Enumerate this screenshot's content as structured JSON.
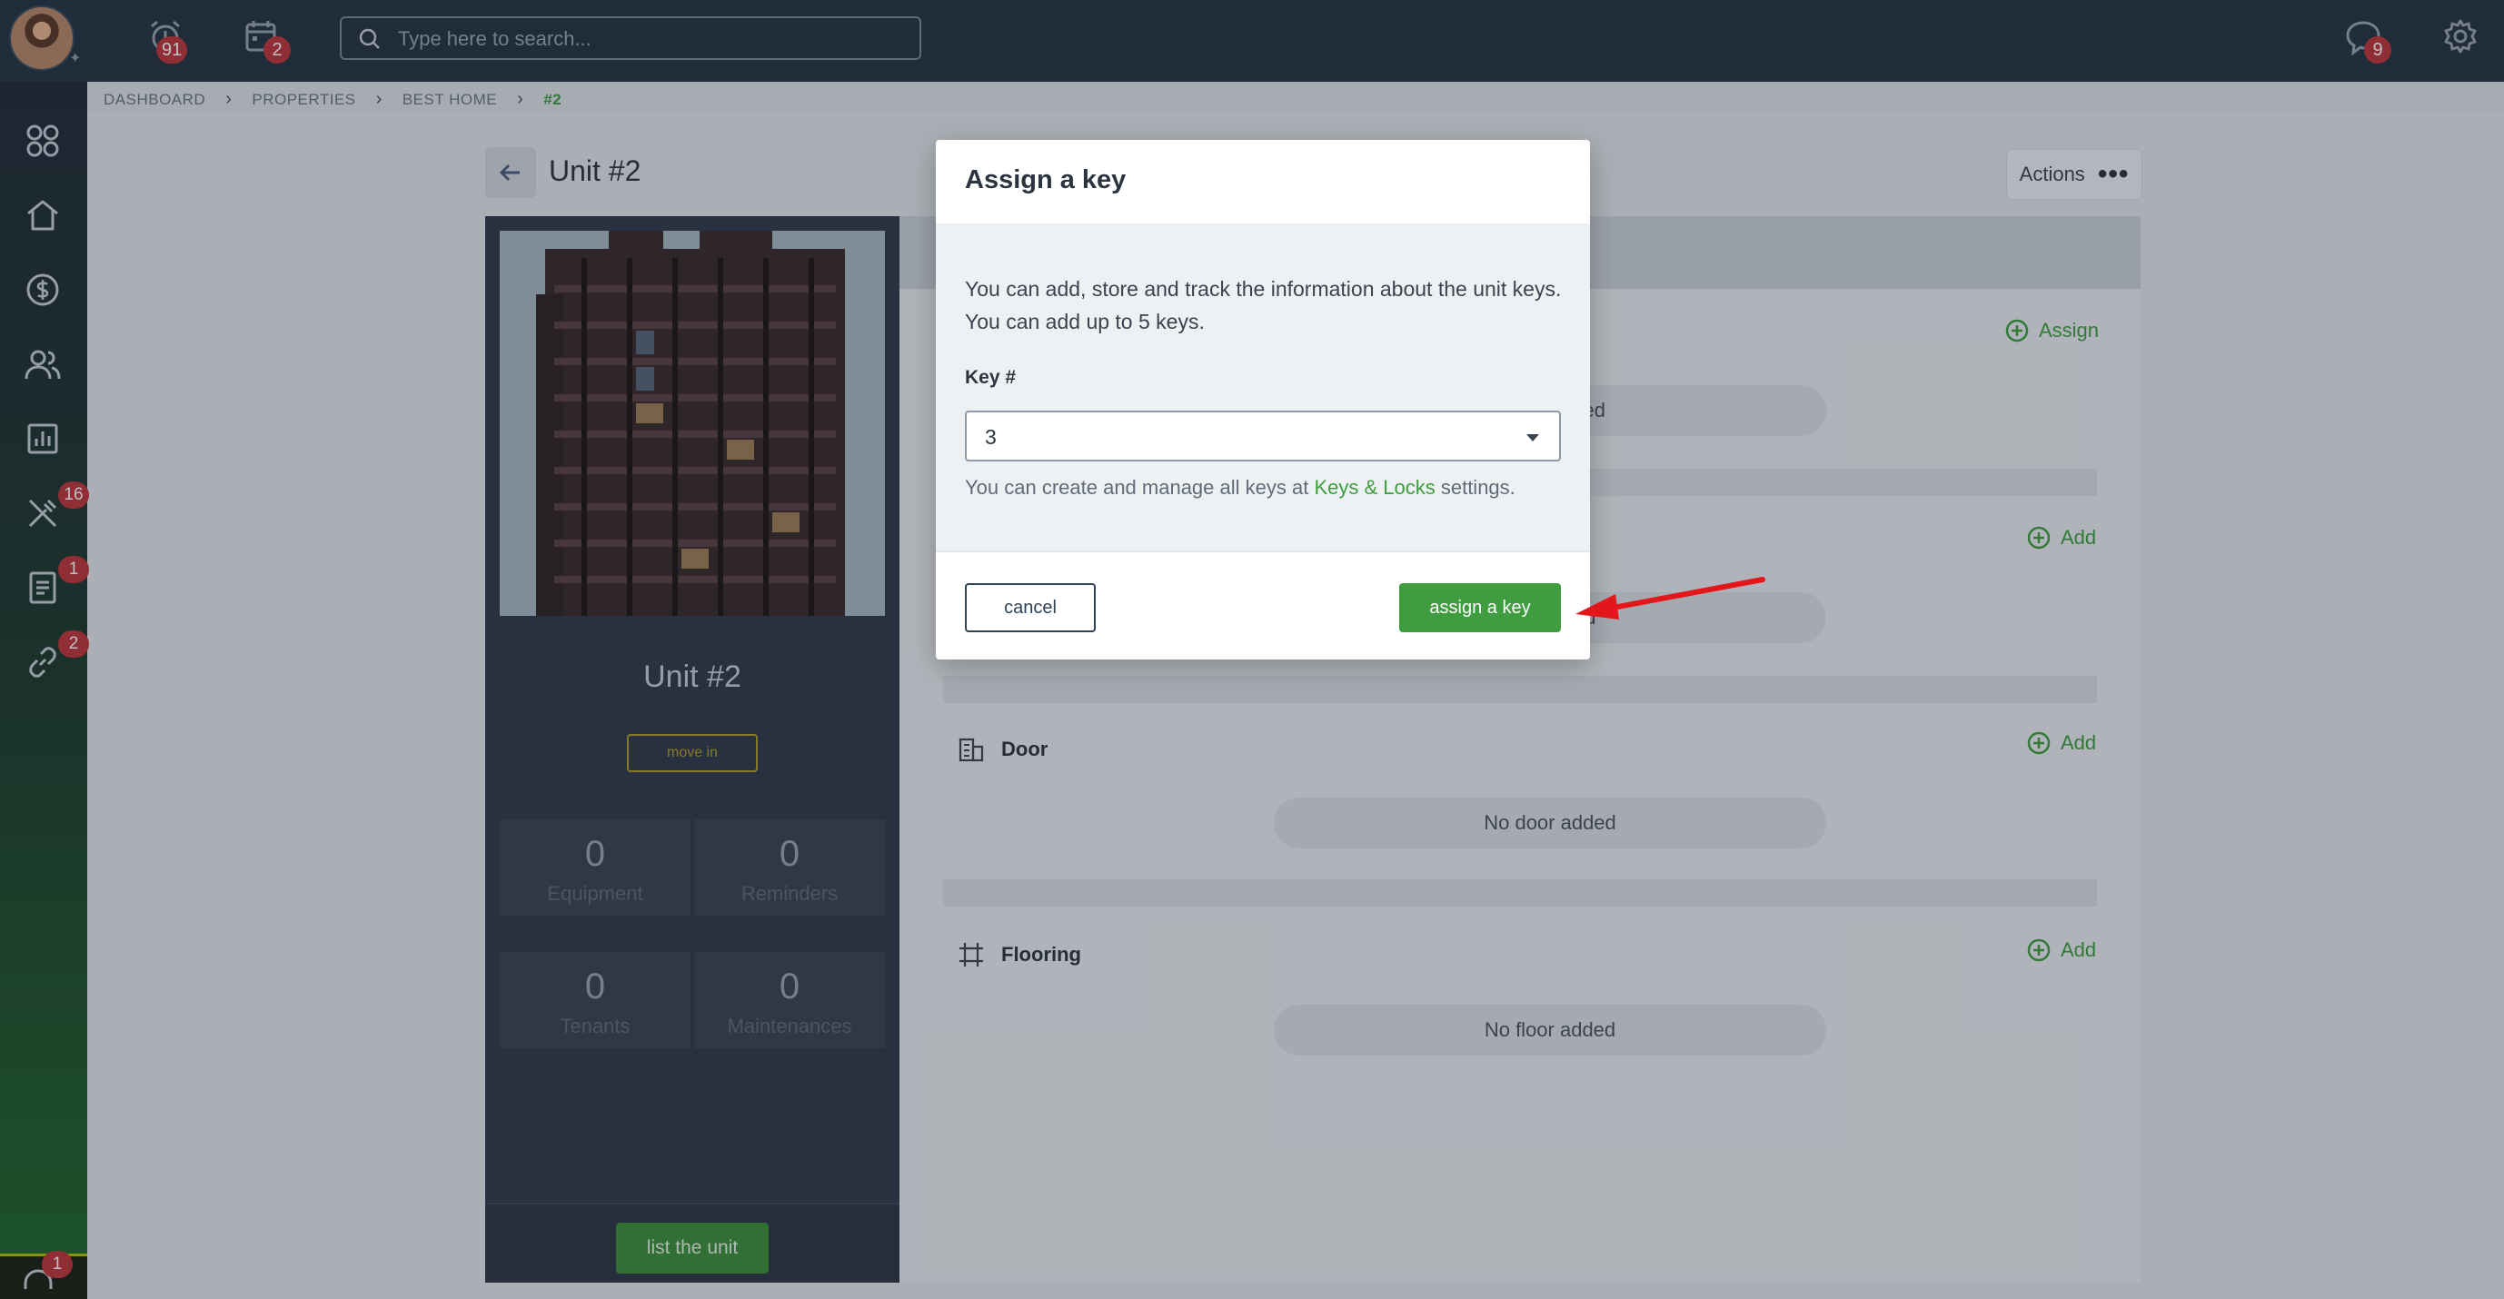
{
  "topbar": {
    "reminders_badge": "91",
    "calendar_badge": "2",
    "search_placeholder": "Type here to search...",
    "messages_badge": "9"
  },
  "sidebar": {
    "items": [
      {
        "name": "dashboard",
        "icon": "grid-icon",
        "badge": ""
      },
      {
        "name": "properties",
        "icon": "home-icon",
        "badge": ""
      },
      {
        "name": "accounting",
        "icon": "dollar-icon",
        "badge": ""
      },
      {
        "name": "people",
        "icon": "users-icon",
        "badge": ""
      },
      {
        "name": "reports",
        "icon": "chart-icon",
        "badge": ""
      },
      {
        "name": "maintenance",
        "icon": "tools-icon",
        "badge": "16"
      },
      {
        "name": "documents",
        "icon": "document-icon",
        "badge": "1"
      },
      {
        "name": "integrations",
        "icon": "link-icon",
        "badge": "2"
      }
    ],
    "bottom_badge": "1"
  },
  "breadcrumb": {
    "items": [
      "DASHBOARD",
      "PROPERTIES",
      "BEST HOME"
    ],
    "current": "#2"
  },
  "page": {
    "title": "Unit #2",
    "actions_label": "Actions"
  },
  "unit_panel": {
    "name": "Unit #2",
    "move_in_label": "move in",
    "stats": [
      {
        "value": "0",
        "label": "Equipment"
      },
      {
        "value": "0",
        "label": "Reminders"
      },
      {
        "value": "0",
        "label": "Tenants"
      },
      {
        "value": "0",
        "label": "Maintenances"
      }
    ],
    "list_button": "list the unit"
  },
  "content": {
    "keys_button": "Assign",
    "keys_empty_partial": "gned",
    "locks_button": "Add",
    "locks_empty_partial": "ed",
    "door": {
      "title": "Door",
      "button": "Add",
      "empty": "No door added"
    },
    "flooring": {
      "title": "Flooring",
      "button": "Add",
      "empty": "No floor added"
    }
  },
  "modal": {
    "title": "Assign a key",
    "description": "You can add, store and track the information about the unit keys. You can add up to 5 keys.",
    "key_label": "Key #",
    "key_value": "3",
    "hint_prefix": "You can create and manage all keys at ",
    "hint_link": "Keys & Locks",
    "hint_suffix": " settings.",
    "cancel_label": "cancel",
    "assign_label": "assign a key"
  },
  "colors": {
    "brand_green": "#3f9d3f",
    "topbar_bg": "#253242",
    "badge_red": "#c0353b",
    "annotation_arrow": "#e3161c"
  }
}
